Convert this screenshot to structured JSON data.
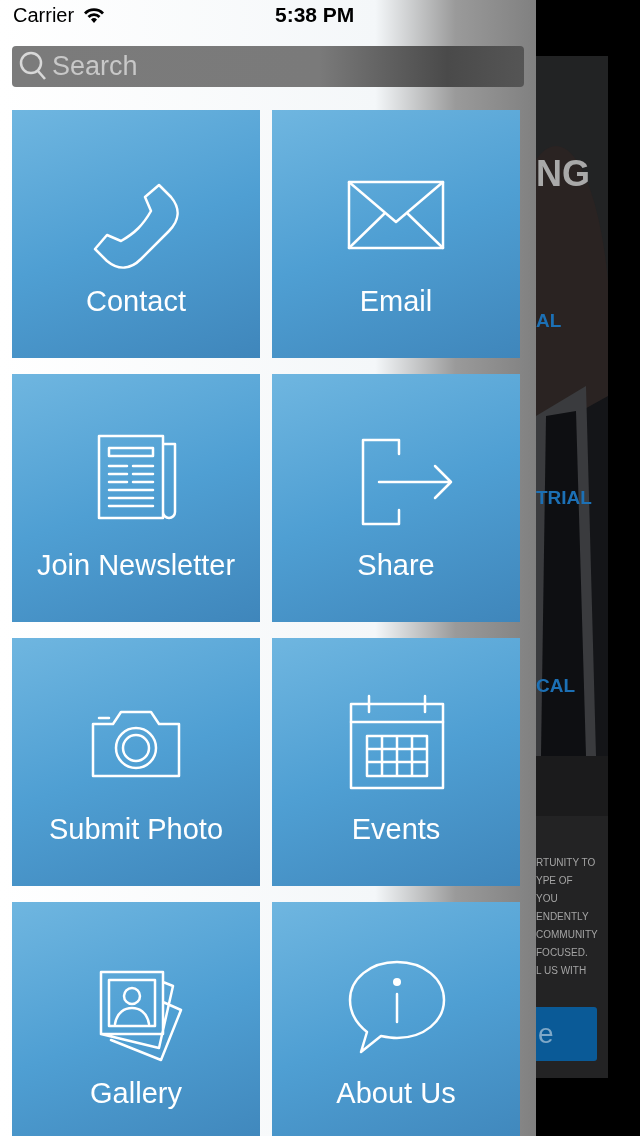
{
  "status_bar": {
    "carrier": "Carrier",
    "time": "5:38 PM"
  },
  "search": {
    "placeholder": "Search"
  },
  "tiles": [
    {
      "label": "Contact"
    },
    {
      "label": "Email"
    },
    {
      "label": "Join Newsletter"
    },
    {
      "label": "Share"
    },
    {
      "label": "Submit Photo"
    },
    {
      "label": "Events"
    },
    {
      "label": "Gallery"
    },
    {
      "label": "About Us"
    }
  ],
  "background_page": {
    "heading": "NG",
    "items": [
      "AL",
      "TRIAL",
      "CAL"
    ],
    "paragraph_lines": [
      "RTUNITY TO",
      "YPE OF",
      "YOU",
      "ENDENTLY",
      "COMMUNITY",
      "FOCUSED.",
      "L US WITH"
    ],
    "button": "e"
  }
}
